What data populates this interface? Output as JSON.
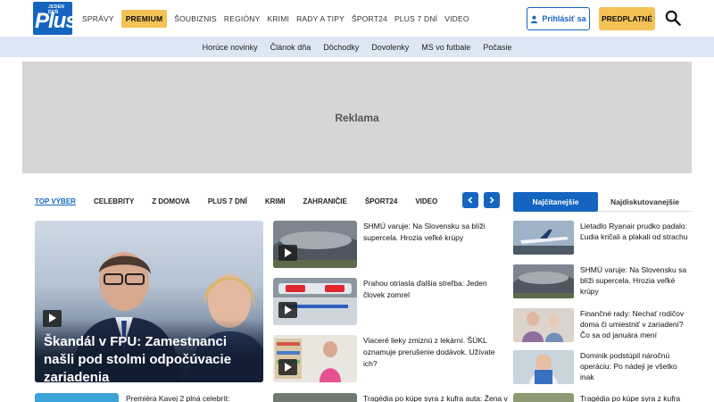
{
  "header": {
    "logo_tag": "JEDEN DEŇ",
    "logo_word": "Plus",
    "nav": [
      "SPRÁVY",
      "PREMIUM",
      "ŠOUBIZNIS",
      "REGIÓNY",
      "KRIMI",
      "RADY A TIPY",
      "ŠPORT24",
      "PLUS 7 DNÍ",
      "VIDEO"
    ],
    "login_label": "Prihlásiť sa",
    "subscribe_label": "PREDPLATNÉ"
  },
  "subnav": [
    "Horúce novinky",
    "Článok dňa",
    "Dôchodky",
    "Dovolenky",
    "MS vo futbale",
    "Počasie"
  ],
  "ad_label": "Reklama",
  "tabs": [
    "TOP VÝBER",
    "CELEBRITY",
    "Z DOMOVA",
    "PLUS 7 DNÍ",
    "KRIMI",
    "ZAHRANIČIE",
    "ŠPORT24",
    "VIDEO"
  ],
  "side_tabs": {
    "active": "Najčítanejšie",
    "other": "Najdiskutovanejšie"
  },
  "hero": {
    "title": "Škandál v FPU: Zamestnanci našli pod stolmi odpočúvacie zariadenia"
  },
  "middle": [
    "SHMÚ varuje: Na Slovensku sa blíži supercela. Hrozia veľké krúpy",
    "Prahou otriasla ďalšia streľba: Jeden človek zomrel",
    "Viaceré lieky zmiznú z lekární. ŠÚKL oznamuje prerušenie dodávok. Užívate ich?"
  ],
  "side": [
    "Lietadlo Ryanair prudko padalo: Ľudia kričali a plakali od strachu",
    "SHMÚ varuje: Na Slovensku sa blíži supercela. Hrozia veľké krúpy",
    "Finančné rady: Nechať rodičov doma či umiestniť v zariadení? Čo sa od januára mení",
    "Dominik podstúpil náročnú operáciu: Po nádeji je všetko inak"
  ],
  "bottom": [
    "Premiéra Kavej 2 plná celebrít:",
    "Tragédia po kúpe syra z kufra auta: Žena v",
    "Tragédia po kúpe syra z kufra"
  ],
  "colors": {
    "brand": "#1565c0",
    "premium": "#f4c255",
    "subnav_bg": "#dde7f3",
    "ad_bg": "#d6d6d6"
  }
}
